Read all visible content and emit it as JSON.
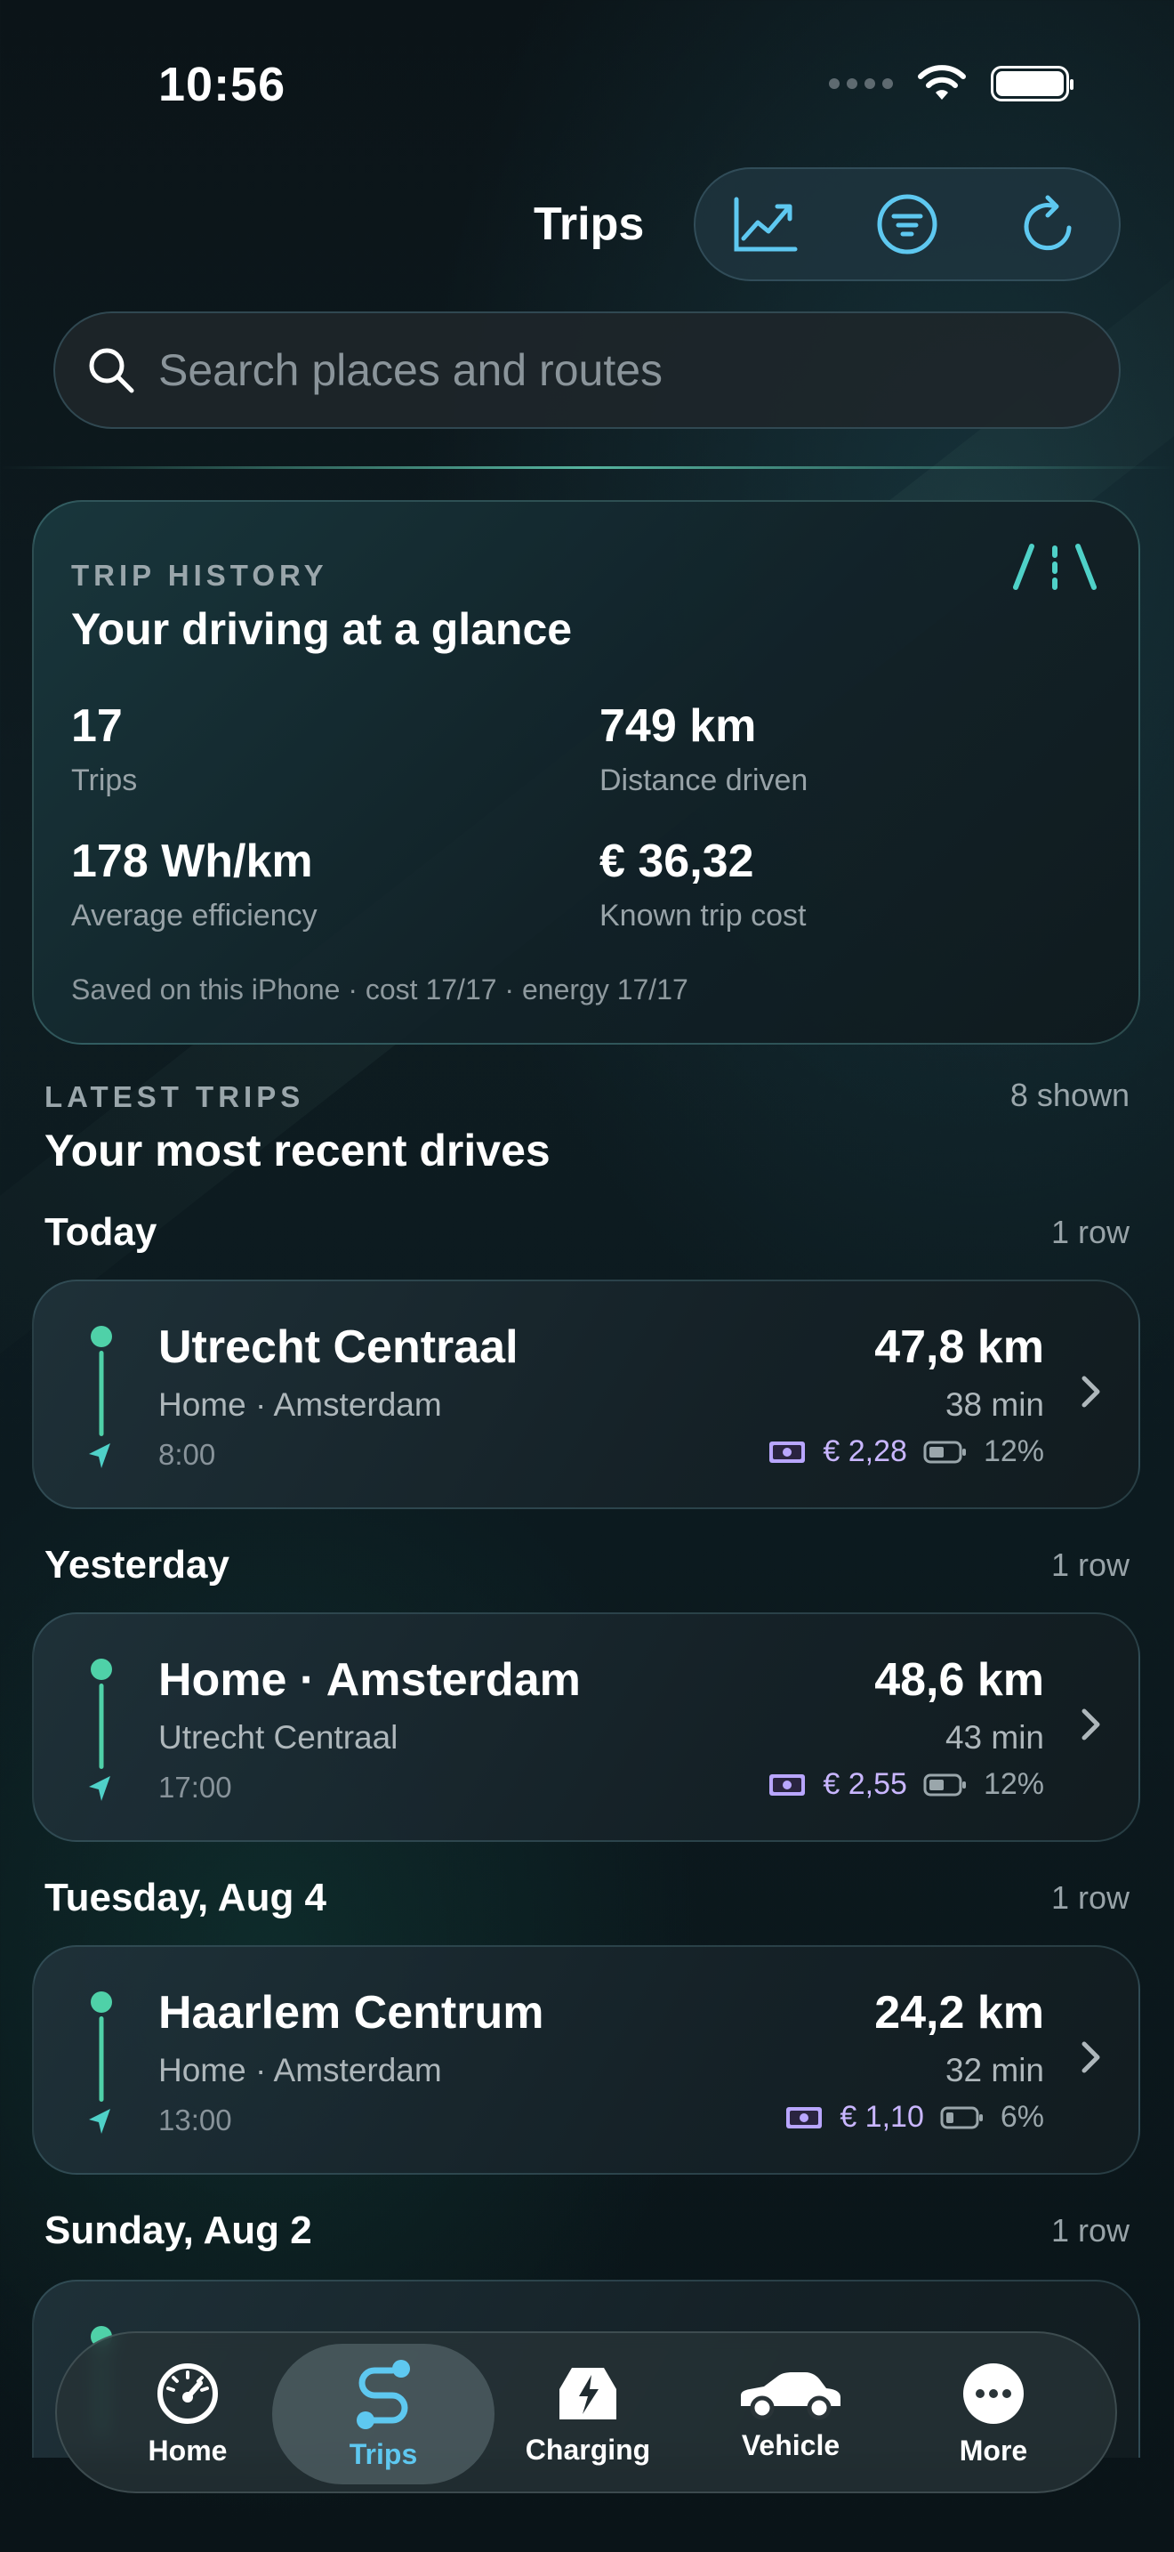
{
  "status_bar": {
    "time": "10:56"
  },
  "header": {
    "title": "Trips",
    "actions": [
      "chart-icon",
      "filter-icon",
      "refresh-icon"
    ]
  },
  "search": {
    "placeholder": "Search places and routes",
    "value": ""
  },
  "summary": {
    "eyebrow": "TRIP HISTORY",
    "title": "Your driving at a glance",
    "stats": [
      {
        "value": "17",
        "label": "Trips"
      },
      {
        "value": "749 km",
        "label": "Distance driven"
      },
      {
        "value": "178 Wh/km",
        "label": "Average efficiency"
      },
      {
        "value": "€ 36,32",
        "label": "Known trip cost"
      }
    ],
    "footnote": "Saved on this iPhone · cost 17/17 · energy 17/17"
  },
  "latest": {
    "eyebrow": "LATEST TRIPS",
    "count": "8 shown",
    "title": "Your most recent drives"
  },
  "groups": [
    {
      "label": "Today",
      "count": "1 row",
      "trip": {
        "destination": "Utrecht Centraal",
        "origin": "Home · Amsterdam",
        "time": "8:00",
        "distance": "47,8 km",
        "duration": "38 min",
        "cost": "€ 2,28",
        "battery": "12%"
      }
    },
    {
      "label": "Yesterday",
      "count": "1 row",
      "trip": {
        "destination": "Home · Amsterdam",
        "origin": "Utrecht Centraal",
        "time": "17:00",
        "distance": "48,6 km",
        "duration": "43 min",
        "cost": "€ 2,55",
        "battery": "12%"
      }
    },
    {
      "label": "Tuesday, Aug 4",
      "count": "1 row",
      "trip": {
        "destination": "Haarlem Centrum",
        "origin": "Home · Amsterdam",
        "time": "13:00",
        "distance": "24,2 km",
        "duration": "32 min",
        "cost": "€ 1,10",
        "battery": "6%"
      }
    },
    {
      "label": "Sunday, Aug 2",
      "count": "1 row"
    }
  ],
  "tabbar": {
    "tabs": [
      {
        "label": "Home",
        "icon": "speedometer-icon"
      },
      {
        "label": "Trips",
        "icon": "route-icon",
        "active": true
      },
      {
        "label": "Charging",
        "icon": "charging-icon"
      },
      {
        "label": "Vehicle",
        "icon": "car-icon"
      },
      {
        "label": "More",
        "icon": "more-icon"
      }
    ]
  },
  "colors": {
    "accent_teal": "#4fd1a8",
    "accent_blue": "#5ec8f0",
    "cost_purple": "#c9b6ff"
  }
}
